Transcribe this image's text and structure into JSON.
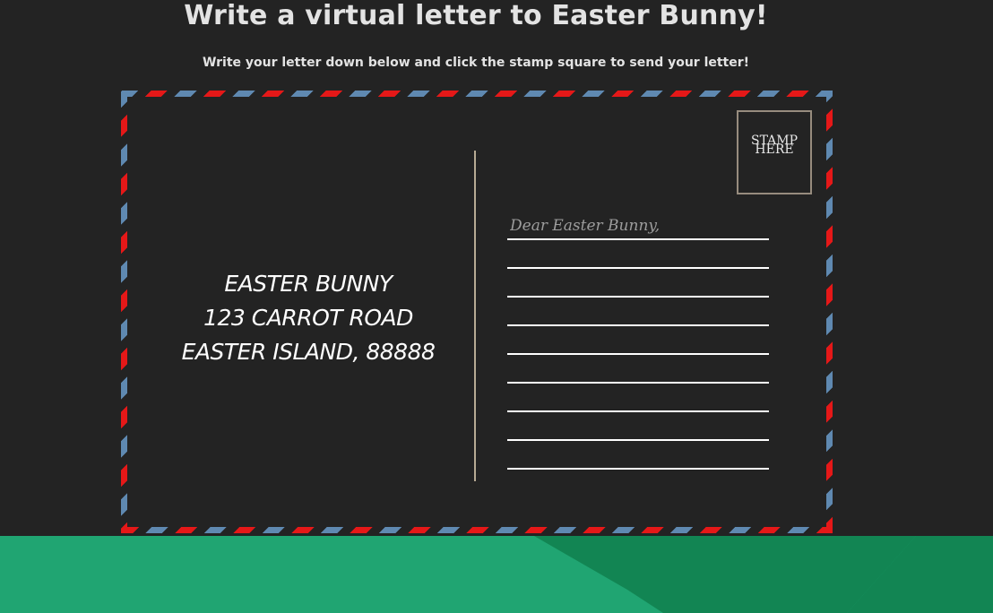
{
  "header": {
    "title": "Write a virtual letter to Easter Bunny!",
    "subtitle": "Write your letter down below and click the stamp square to send your letter!"
  },
  "postcard": {
    "stamp": {
      "label_line1": "STAMP",
      "label_line2": "HERE"
    },
    "address": {
      "line1": "EASTER BUNNY",
      "line2": "123 CARROT ROAD",
      "line3": "EASTER ISLAND, 88888"
    },
    "letter": {
      "lines": [
        {
          "value": "",
          "placeholder": "Dear Easter Bunny,"
        },
        {
          "value": "",
          "placeholder": ""
        },
        {
          "value": "",
          "placeholder": ""
        },
        {
          "value": "",
          "placeholder": ""
        },
        {
          "value": "",
          "placeholder": ""
        },
        {
          "value": "",
          "placeholder": ""
        },
        {
          "value": "",
          "placeholder": ""
        },
        {
          "value": "",
          "placeholder": ""
        },
        {
          "value": "",
          "placeholder": ""
        }
      ]
    }
  },
  "colors": {
    "background": "#232323",
    "airmail_red": "#e51818",
    "airmail_blue": "#5f89b1",
    "divider": "#b7aa94",
    "stamp_border": "#978c7e",
    "hill_light": "#20a572",
    "hill_dark": "#128553"
  }
}
